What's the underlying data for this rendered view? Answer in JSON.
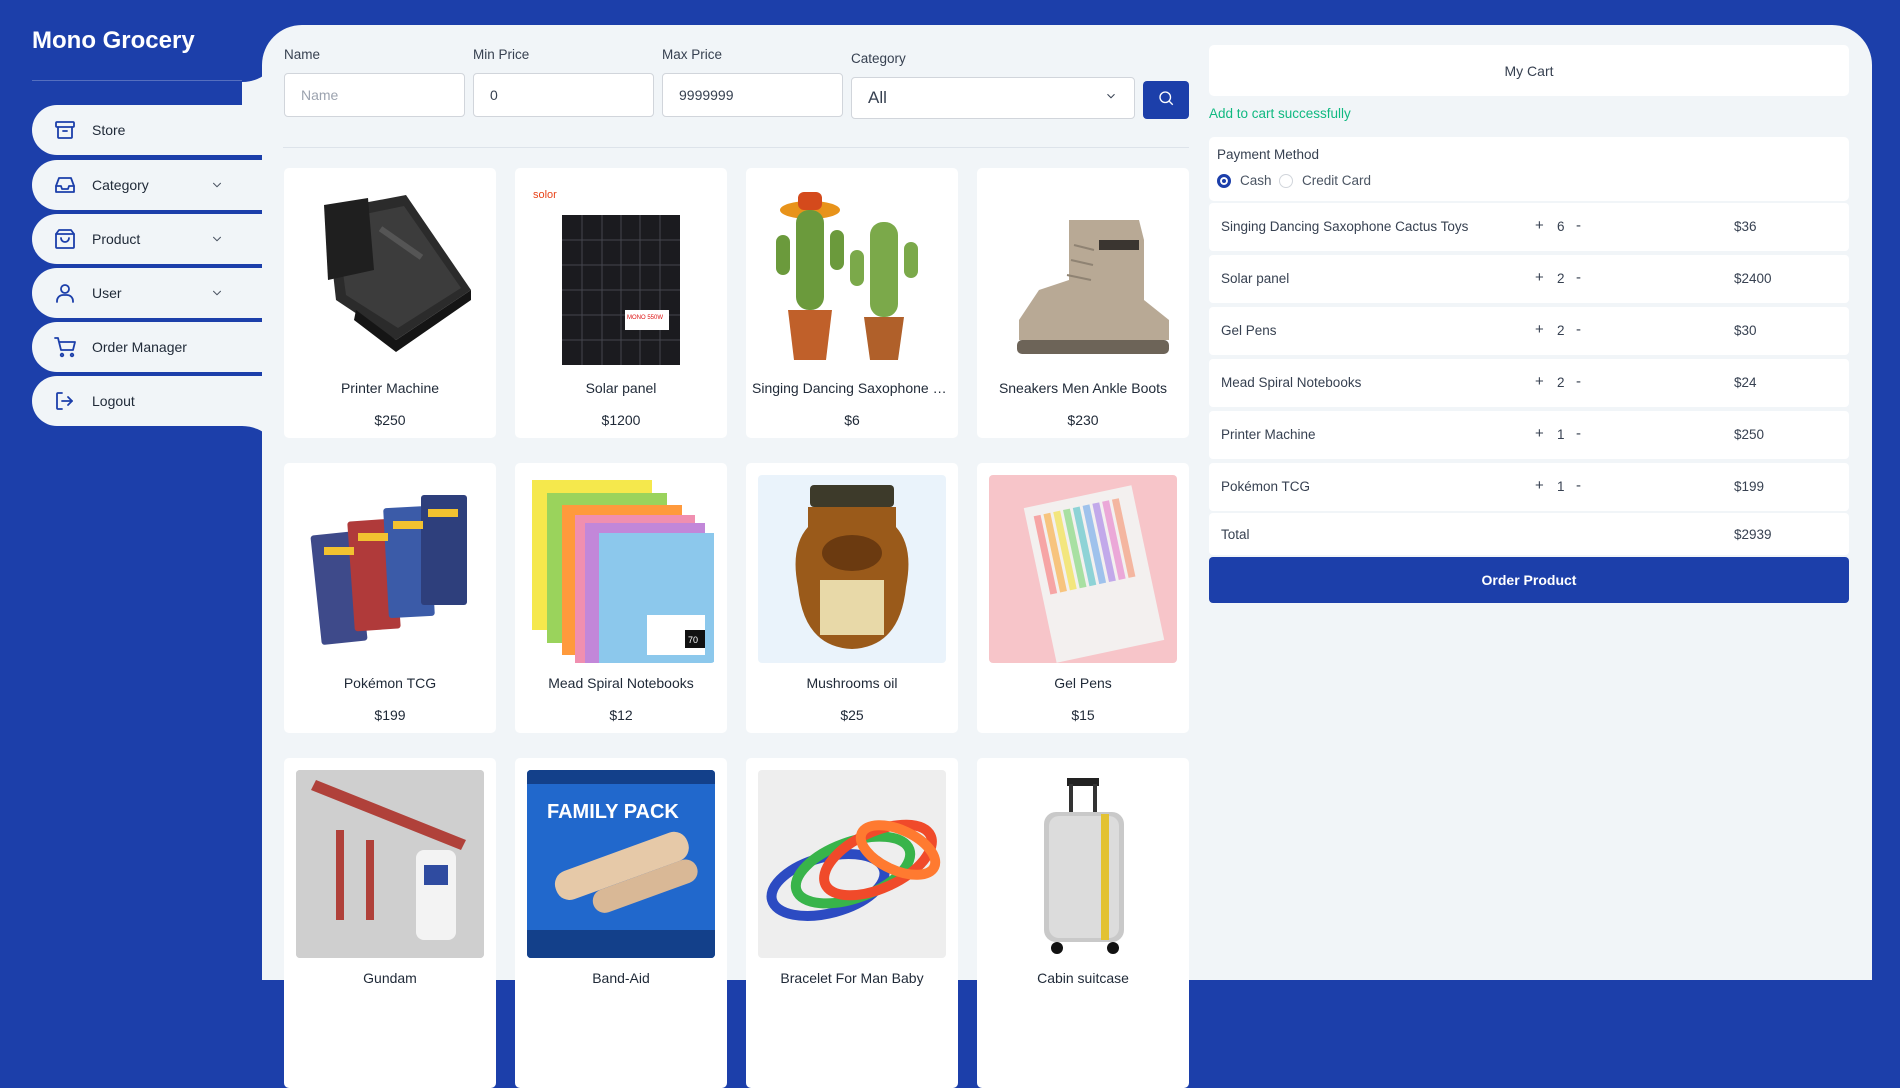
{
  "app": {
    "title": "Mono Grocery"
  },
  "sidebar": {
    "items": [
      {
        "label": "Store",
        "icon": "archive-box-icon",
        "expandable": false
      },
      {
        "label": "Category",
        "icon": "inbox-tray-icon",
        "expandable": true
      },
      {
        "label": "Product",
        "icon": "shopping-bag-icon",
        "expandable": true
      },
      {
        "label": "User",
        "icon": "user-icon",
        "expandable": true
      },
      {
        "label": "Order Manager",
        "icon": "shopping-cart-icon",
        "expandable": false
      },
      {
        "label": "Logout",
        "icon": "logout-arrow-icon",
        "expandable": false
      }
    ]
  },
  "filters": {
    "name_label": "Name",
    "name_placeholder": "Name",
    "name_value": "",
    "min_label": "Min Price",
    "min_value": "0",
    "max_label": "Max Price",
    "max_value": "9999999",
    "category_label": "Category",
    "category_value": "All"
  },
  "products": [
    {
      "name": "Printer Machine",
      "price": "$250"
    },
    {
      "name": "Solar panel",
      "price": "$1200"
    },
    {
      "name": "Singing Dancing Saxophone Cactus Toys",
      "price": "$6"
    },
    {
      "name": "Sneakers Men Ankle Boots",
      "price": "$230"
    },
    {
      "name": "Pokémon TCG",
      "price": "$199"
    },
    {
      "name": "Mead Spiral Notebooks",
      "price": "$12"
    },
    {
      "name": "Mushrooms oil",
      "price": "$25"
    },
    {
      "name": "Gel Pens",
      "price": "$15"
    },
    {
      "name": "Gundam",
      "price": ""
    },
    {
      "name": "Band-Aid",
      "price": ""
    },
    {
      "name": "Bracelet For Man Baby",
      "price": ""
    },
    {
      "name": "Cabin suitcase",
      "price": ""
    }
  ],
  "product_art": {
    "solar_brand": "solor",
    "solar_tag": "MONO 550W",
    "bandaid_title": "FAMILY PACK",
    "notebook_count": "70"
  },
  "cart": {
    "title": "My Cart",
    "message": "Add to cart successfully",
    "payment_title": "Payment Method",
    "payment_options": [
      {
        "label": "Cash",
        "selected": true
      },
      {
        "label": "Credit Card",
        "selected": false
      }
    ],
    "items": [
      {
        "name": "Singing Dancing Saxophone Cactus Toys",
        "qty": "6",
        "price": "$36"
      },
      {
        "name": "Solar panel",
        "qty": "2",
        "price": "$2400"
      },
      {
        "name": "Gel Pens",
        "qty": "2",
        "price": "$30"
      },
      {
        "name": "Mead Spiral Notebooks",
        "qty": "2",
        "price": "$24"
      },
      {
        "name": "Printer Machine",
        "qty": "1",
        "price": "$250"
      },
      {
        "name": "Pokémon TCG",
        "qty": "1",
        "price": "$199"
      }
    ],
    "plus_symbol": "+",
    "minus_symbol": "-",
    "total_label": "Total",
    "total_value": "$2939",
    "order_button": "Order Product"
  },
  "colors": {
    "brand": "#1c3faa",
    "background": "#f1f5f8",
    "success": "#10b981"
  }
}
